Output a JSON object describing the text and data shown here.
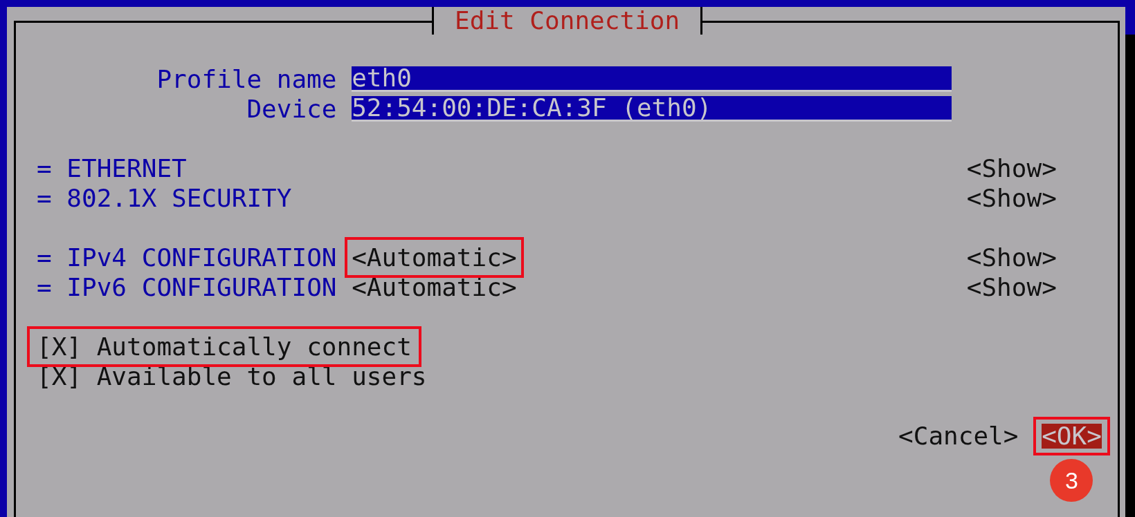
{
  "dialog": {
    "title": "Edit Connection"
  },
  "fields": [
    {
      "label": "Profile name",
      "value": "eth0"
    },
    {
      "label": "Device",
      "value": "52:54:00:DE:CA:3F (eth0)"
    }
  ],
  "section_groups": [
    [
      {
        "title": "= ETHERNET",
        "button": "<Show>"
      },
      {
        "title": "= 802.1X SECURITY",
        "button": "<Show>"
      }
    ],
    [
      {
        "title": "= IPv4 CONFIGURATION",
        "mode": "<Automatic>",
        "mode_highlighted": true,
        "button": "<Show>"
      },
      {
        "title": "= IPv6 CONFIGURATION",
        "mode": "<Automatic>",
        "mode_highlighted": false,
        "button": "<Show>"
      }
    ]
  ],
  "checkboxes": [
    {
      "mark": "[X]",
      "label": "Automatically connect",
      "checked": true,
      "highlighted": true
    },
    {
      "mark": "[X]",
      "label": "Available to all users",
      "checked": true,
      "highlighted": false
    }
  ],
  "buttons": [
    {
      "label": "<Cancel>",
      "focused": false,
      "highlighted": false
    },
    {
      "label": "<OK>",
      "focused": true,
      "highlighted": true,
      "step": "3"
    }
  ]
}
